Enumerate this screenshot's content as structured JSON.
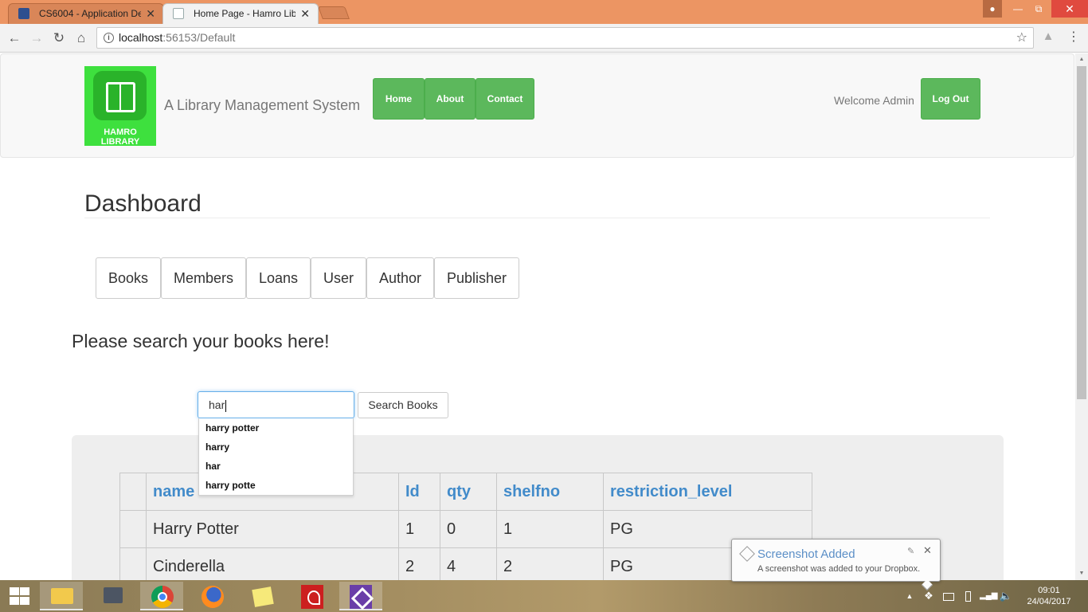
{
  "browser": {
    "tabs": [
      {
        "title": "CS6004 - Application De",
        "close": "✕",
        "active": false
      },
      {
        "title": "Home Page - Hamro Libr",
        "close": "✕",
        "active": true
      }
    ],
    "address": {
      "host": "localhost",
      "rest": ":56153/Default"
    }
  },
  "site": {
    "logo_text": "HAMRO LIBRARY",
    "tagline": "A Library Management System",
    "nav": {
      "home": "Home",
      "about": "About",
      "contact": "Contact"
    },
    "welcome": "Welcome Admin",
    "logout": "Log Out"
  },
  "dashboard": {
    "title": "Dashboard",
    "menu": [
      "Books",
      "Members",
      "Loans",
      "User",
      "Author",
      "Publisher"
    ]
  },
  "search": {
    "heading": "Please search your books here!",
    "input_value": "har",
    "button": "Search Books",
    "suggestions": [
      "harry potter",
      "harry",
      "har",
      "harry potte"
    ]
  },
  "table": {
    "headers": [
      "",
      "name",
      "Id",
      "qty",
      "shelfno",
      "restriction_level"
    ],
    "rows": [
      [
        "",
        "Harry Potter",
        "1",
        "0",
        "1",
        "PG"
      ],
      [
        "",
        "Cinderella",
        "2",
        "4",
        "2",
        "PG"
      ]
    ]
  },
  "notification": {
    "title": "Screenshot Added",
    "message": "A screenshot was added to your Dropbox."
  },
  "taskbar": {
    "time": "09:01",
    "date": "24/04/2017"
  },
  "colors": {
    "title_bar": "#ec9563",
    "nav_green": "#5cb85c",
    "link_blue": "#428bca",
    "logo_green": "#3ee03e"
  }
}
